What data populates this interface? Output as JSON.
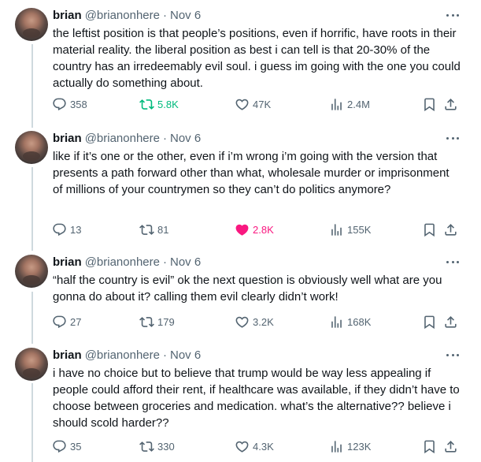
{
  "tweets": [
    {
      "name": "brian",
      "handle": "@brianonhere",
      "separator": "·",
      "date": "Nov 6",
      "text": "the leftist position is that people’s positions, even if horrific, have roots in their material reality. the liberal position as best i can tell is that 20-30% of the country has an irredeemably evil soul. i guess im going with the one you could actually do something about.",
      "replies": "358",
      "retweets": "5.8K",
      "likes": "47K",
      "views": "2.4M",
      "retweeted": true,
      "liked": false
    },
    {
      "name": "brian",
      "handle": "@brianonhere",
      "separator": "·",
      "date": "Nov 6",
      "text": "like if it’s one or the other, even if i’m wrong i’m going with the version that presents a path forward other than what, wholesale murder or imprisonment of millions of your countrymen so they can’t do politics anymore?",
      "replies": "13",
      "retweets": "81",
      "likes": "2.8K",
      "views": "155K",
      "retweeted": false,
      "liked": true
    },
    {
      "name": "brian",
      "handle": "@brianonhere",
      "separator": "·",
      "date": "Nov 6",
      "text": "“half the country is evil” ok the next question is obviously well what are you gonna do about it? calling them evil clearly didn’t work!",
      "replies": "27",
      "retweets": "179",
      "likes": "3.2K",
      "views": "168K",
      "retweeted": false,
      "liked": false
    },
    {
      "name": "brian",
      "handle": "@brianonhere",
      "separator": "·",
      "date": "Nov 6",
      "text": "i have no choice but to believe that trump would be way less appealing if people could afford their rent, if healthcare was available, if they didn’t have to choose between groceries and medication. what’s the alternative?? believe i should scold harder??",
      "replies": "35",
      "retweets": "330",
      "likes": "4.3K",
      "views": "123K",
      "retweeted": false,
      "liked": false
    }
  ],
  "icons": {
    "reply": "reply-icon",
    "retweet": "retweet-icon",
    "like": "heart-icon",
    "views": "views-chart-icon",
    "bookmark": "bookmark-icon",
    "share": "share-icon",
    "more": "more-dots-icon"
  },
  "colors": {
    "text": "#0f1419",
    "secondary": "#536471",
    "retweet_active": "#00ba7c",
    "like_active": "#f91880",
    "thread_line": "#cfd9de"
  }
}
